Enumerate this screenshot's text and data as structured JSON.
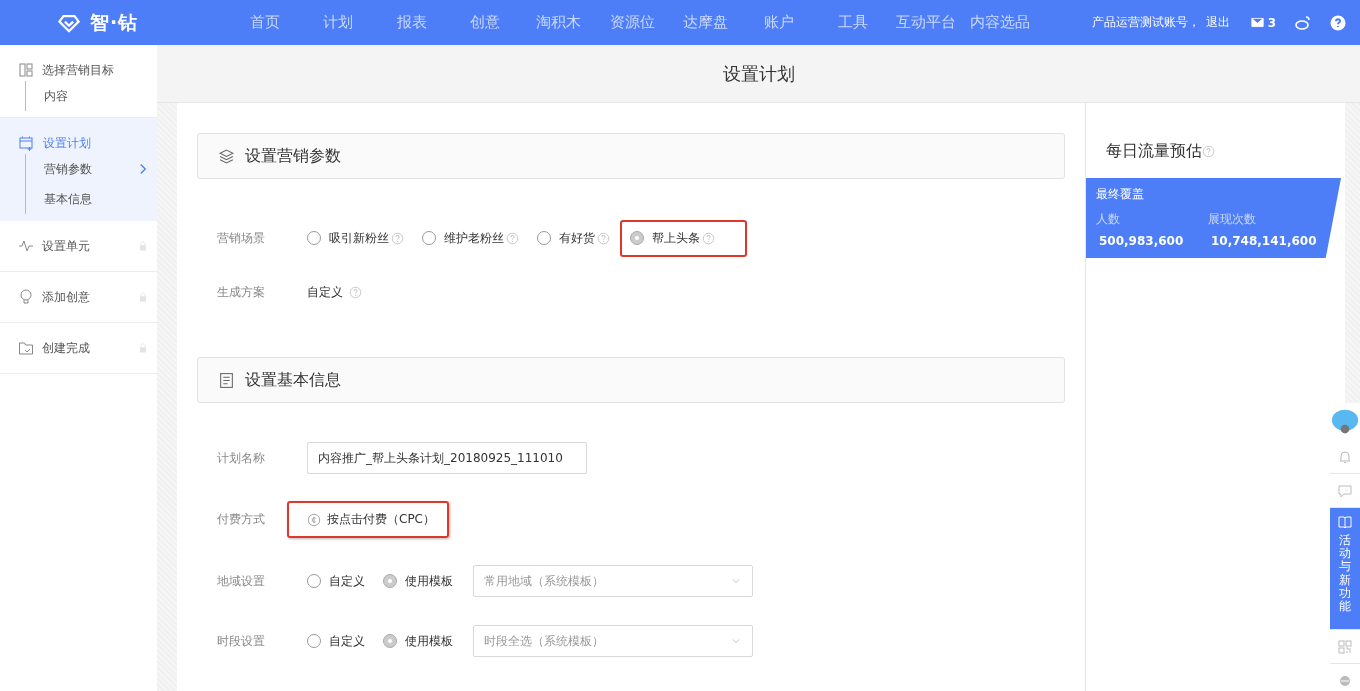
{
  "topbar": {
    "logo": "智·钻",
    "nav": [
      "首页",
      "计划",
      "报表",
      "创意",
      "淘积木",
      "资源位",
      "达摩盘",
      "账户",
      "工具",
      "互动平台",
      "内容选品"
    ],
    "account": "产品运营测试账号，",
    "logout": "退出",
    "mail_count": "3"
  },
  "sidebar": {
    "steps": [
      {
        "label": "选择营销目标",
        "selected": false,
        "locked": false,
        "children": [
          {
            "label": "内容",
            "current": false
          }
        ]
      },
      {
        "label": "设置计划",
        "selected": true,
        "locked": false,
        "children": [
          {
            "label": "营销参数",
            "current": true
          },
          {
            "label": "基本信息",
            "current": false
          }
        ]
      },
      {
        "label": "设置单元",
        "selected": false,
        "locked": true
      },
      {
        "label": "添加创意",
        "selected": false,
        "locked": true
      },
      {
        "label": "创建完成",
        "selected": false,
        "locked": true
      }
    ]
  },
  "page_title": "设置计划",
  "sections": [
    {
      "title": "设置营销参数",
      "rows": [
        {
          "kind": "radios",
          "label": "营销场景",
          "options": [
            {
              "label": "吸引新粉丝",
              "selected": false,
              "highlighted": false,
              "help": true
            },
            {
              "label": "维护老粉丝",
              "selected": false,
              "highlighted": false,
              "help": true
            },
            {
              "label": "有好货",
              "selected": false,
              "highlighted": false,
              "help": true
            },
            {
              "label": "帮上头条",
              "selected": true,
              "highlighted": true,
              "help": true
            }
          ]
        },
        {
          "kind": "text",
          "label": "生成方案",
          "value": "自定义",
          "help": true
        }
      ]
    },
    {
      "title": "设置基本信息",
      "rows": [
        {
          "kind": "input",
          "label": "计划名称",
          "value": "内容推广_帮上头条计划_20180925_111010"
        },
        {
          "kind": "pay",
          "label": "付费方式",
          "value": "按点击付费（CPC）",
          "highlighted": true
        },
        {
          "kind": "radios_select",
          "label": "地域设置",
          "options": [
            {
              "label": "自定义",
              "selected": false,
              "highlighted": false,
              "help": false
            },
            {
              "label": "使用模板",
              "selected": true,
              "highlighted": false,
              "help": false
            }
          ],
          "select": "常用地域（系统模板）"
        },
        {
          "kind": "radios_select",
          "label": "时段设置",
          "options": [
            {
              "label": "自定义",
              "selected": false,
              "highlighted": false,
              "help": false
            },
            {
              "label": "使用模板",
              "selected": true,
              "highlighted": false,
              "help": false
            }
          ],
          "select": "时段全选（系统模板）"
        }
      ]
    }
  ],
  "estimate": {
    "title": "每日流量预估",
    "card_title": "最终覆盖",
    "stats": [
      {
        "label": "人数",
        "value": "500,983,600"
      },
      {
        "label": "展现次数",
        "value": "10,748,141,600"
      }
    ]
  },
  "dock": [
    {
      "kind": "mascot"
    },
    {
      "kind": "bell"
    },
    {
      "kind": "chat"
    },
    {
      "kind": "feature",
      "label": "活动与新功能",
      "selected": true
    },
    {
      "kind": "qr"
    },
    {
      "kind": "service"
    }
  ]
}
